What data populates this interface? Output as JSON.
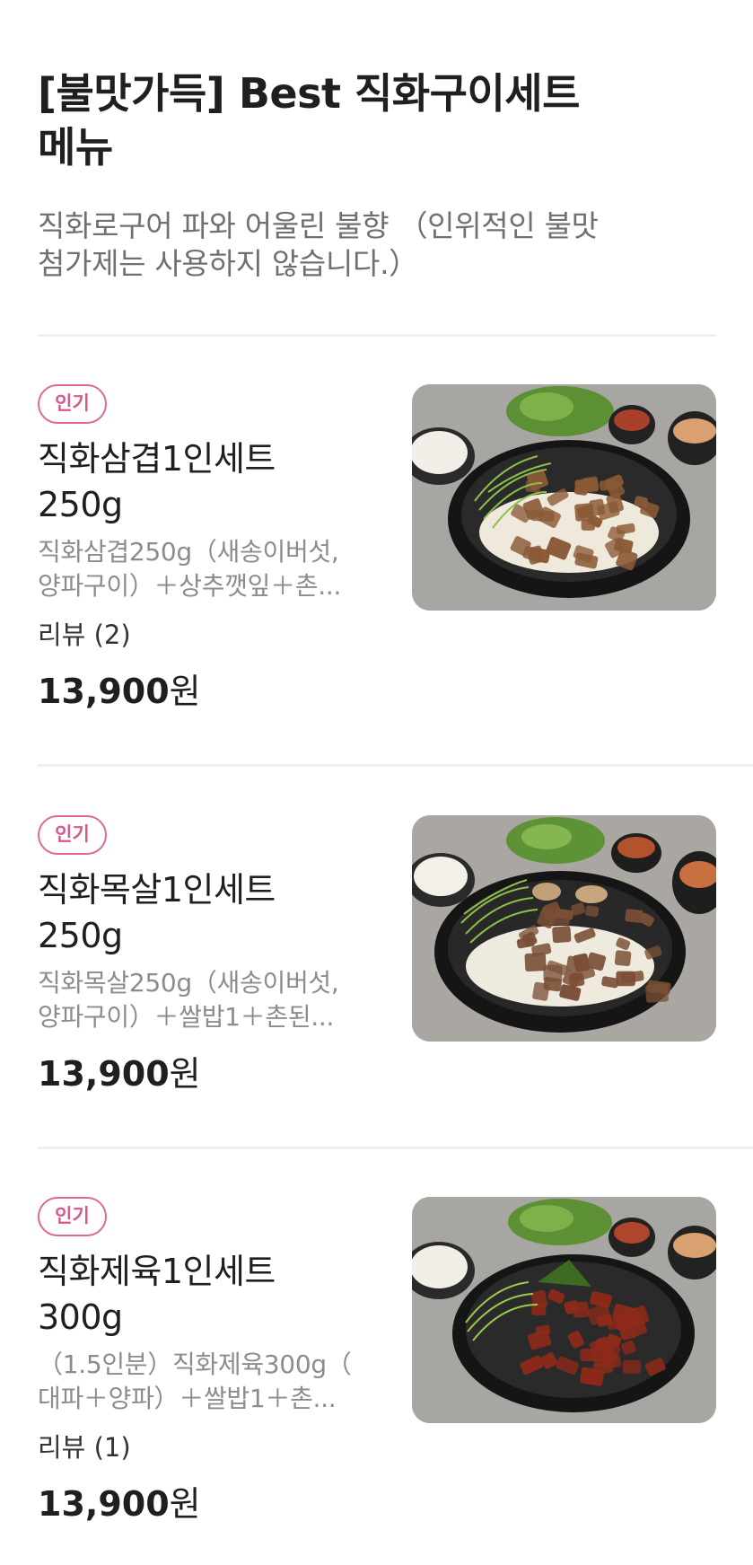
{
  "section": {
    "title_line1": "[불맛가득] Best 직화구이세트",
    "title_line2": "메뉴",
    "description_line1": "직화로구어 파와 어울린 불향 （인위적인 불맛",
    "description_line2": "첨가제는 사용하지 않습니다.）"
  },
  "menu_items": [
    {
      "badge": "인기",
      "name_line1": "직화삼겹1인세트",
      "name_line2": "250g",
      "desc_line1": "직화삼겹250g（새송이버섯,",
      "desc_line2": "양파구이）＋상추깻잎＋촌...",
      "review": "리뷰 (2)",
      "price": "13,900",
      "price_unit": "원",
      "image_icon": "food-photo-samgyeop",
      "meat_color": "#8a5a36"
    },
    {
      "badge": "인기",
      "name_line1": "직화목살1인세트",
      "name_line2": "250g",
      "desc_line1": "직화목살250g（새송이버섯,",
      "desc_line2": "양파구이）＋쌀밥1＋촌된...",
      "price": "13,900",
      "price_unit": "원",
      "image_icon": "food-photo-moksal",
      "meat_color": "#7a4f36"
    },
    {
      "badge": "인기",
      "name_line1": "직화제육1인세트",
      "name_line2": "300g",
      "desc_line1": "（1.5인분）직화제육300g（",
      "desc_line2": "대파＋양파）＋쌀밥1＋촌...",
      "review": "리뷰 (1)",
      "price": "13,900",
      "price_unit": "원",
      "image_icon": "food-photo-jeyuk",
      "meat_color": "#8e2a1a"
    }
  ],
  "colors": {
    "badge": "#e0669a",
    "divider": "#f0f0f0",
    "muted_text": "#8c8c8c"
  }
}
